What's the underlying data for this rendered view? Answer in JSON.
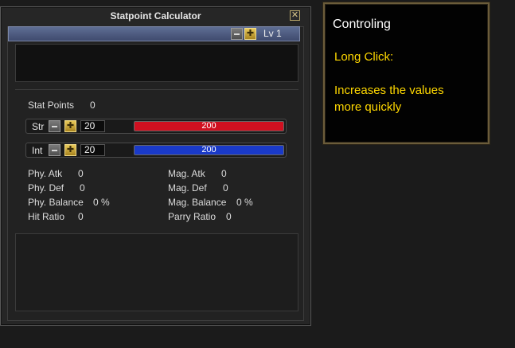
{
  "window": {
    "title": "Statpoint Calculator",
    "close_symbol": "✕"
  },
  "level_bar": {
    "label": "Lv 1",
    "minus_icon": "minus-icon",
    "plus_icon": "plus-icon"
  },
  "stat_points": {
    "label": "Stat Points",
    "value": "0"
  },
  "stats": [
    {
      "name": "Str",
      "value": "20",
      "bar_value": "200",
      "bar_color": "#d01020",
      "bar_fill": 1.0
    },
    {
      "name": "Int",
      "value": "20",
      "bar_value": "200",
      "bar_color": "#1a3ac8",
      "bar_fill": 1.0
    }
  ],
  "attributes_left": [
    {
      "label": "Phy. Atk",
      "value": "0"
    },
    {
      "label": "Phy. Def",
      "value": "0"
    },
    {
      "label": "Phy. Balance",
      "value": "0 %"
    },
    {
      "label": "Hit Ratio",
      "value": "0"
    }
  ],
  "attributes_right": [
    {
      "label": "Mag. Atk",
      "value": "0"
    },
    {
      "label": "Mag. Def",
      "value": "0"
    },
    {
      "label": "Mag. Balance",
      "value": "0 %"
    },
    {
      "label": "Parry Ratio",
      "value": "0"
    }
  ],
  "tooltip": {
    "title": "Controling",
    "heading": "Long Click:",
    "line1": "Increases the values",
    "line2": "more quickly"
  },
  "colors": {
    "tooltip_text": "#ffd800",
    "level_bar": "#4f5c82"
  }
}
